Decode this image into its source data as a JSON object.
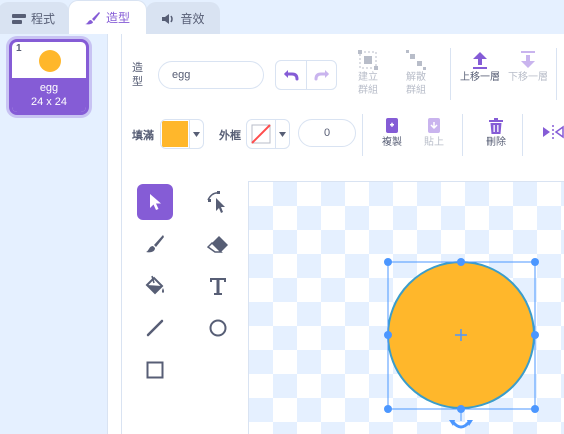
{
  "tabs": [
    {
      "label": "程式",
      "icon": "code-icon",
      "active": false
    },
    {
      "label": "造型",
      "icon": "paintbrush-icon",
      "active": true
    },
    {
      "label": "音效",
      "icon": "speaker-icon",
      "active": false
    }
  ],
  "costume_list": {
    "items": [
      {
        "number": "1",
        "name": "egg",
        "size": "24 x 24",
        "selected": true
      }
    ]
  },
  "toolbar": {
    "costume_label": "造型",
    "costume_name": "egg",
    "undo_icon": "undo-icon",
    "redo_icon": "redo-icon",
    "group_label": "建立群組",
    "ungroup_label": "解散群組",
    "forward_label": "上移一層",
    "backward_label": "下移一層",
    "fill_label": "填滿",
    "outline_label": "外框",
    "outline_width": "0",
    "copy_label": "複製",
    "paste_label": "貼上",
    "delete_label": "刪除"
  },
  "colors": {
    "accent": "#855cd6",
    "fill": "#ffb72b",
    "selection": "#4c97ff",
    "outline_stroke": "#3b9dca"
  },
  "tools": [
    {
      "name": "select-tool",
      "icon": "arrow-icon",
      "active": true
    },
    {
      "name": "reshape-tool",
      "icon": "reshape-icon",
      "active": false
    },
    {
      "name": "brush-tool",
      "icon": "brush-icon",
      "active": false
    },
    {
      "name": "eraser-tool",
      "icon": "eraser-icon",
      "active": false
    },
    {
      "name": "fill-tool",
      "icon": "paint-bucket-icon",
      "active": false
    },
    {
      "name": "text-tool",
      "icon": "text-icon",
      "active": false
    },
    {
      "name": "line-tool",
      "icon": "line-icon",
      "active": false
    },
    {
      "name": "circle-tool",
      "icon": "circle-icon",
      "active": false
    },
    {
      "name": "rectangle-tool",
      "icon": "rectangle-icon",
      "active": false
    }
  ]
}
